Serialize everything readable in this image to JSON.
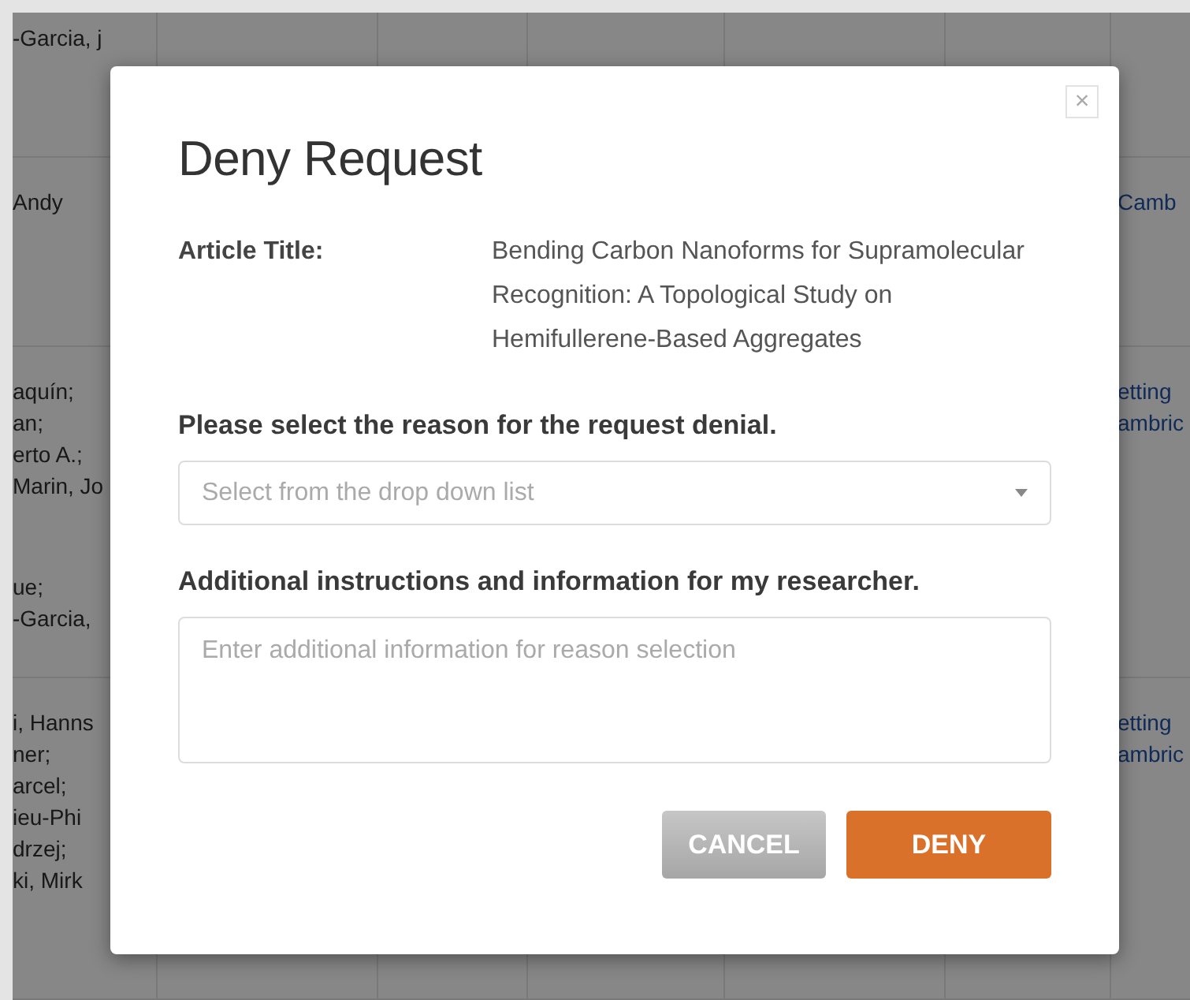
{
  "background_table": {
    "rows": [
      {
        "column_1": [
          [
            "-Garcia, j"
          ]
        ],
        "column_7": []
      },
      {
        "column_1": [
          [
            "Andy"
          ]
        ],
        "column_7": [
          "Camb"
        ]
      },
      {
        "column_1": [
          [
            "aquín;",
            "an;",
            "erto A.;",
            "Marin, Jo"
          ],
          [
            "ue;",
            "-Garcia,"
          ]
        ],
        "column_7": [
          "etting",
          "ambric"
        ]
      },
      {
        "column_1": [
          [
            "i, Hanns",
            "ner;",
            "arcel;",
            "ieu-Phi",
            "drzej;",
            "ki, Mirk"
          ]
        ],
        "column_7": [
          "etting",
          "ambric"
        ]
      }
    ]
  },
  "dialog": {
    "title": "Deny Request",
    "close": "×",
    "article": {
      "label": "Article Title:",
      "value": "Bending Carbon Nanoforms for Supramolecular Recognition: A Topological Study on Hemifullerene-Based Aggregates"
    },
    "reason": {
      "label": "Please select the reason for the request denial.",
      "placeholder": "Select from the drop down list"
    },
    "details": {
      "label": "Additional instructions and information for my researcher.",
      "placeholder": "Enter additional information for reason selection"
    },
    "buttons": [
      {
        "label": "CANCEL",
        "kind": "secondary"
      },
      {
        "label": "DENY",
        "kind": "primary"
      }
    ]
  }
}
